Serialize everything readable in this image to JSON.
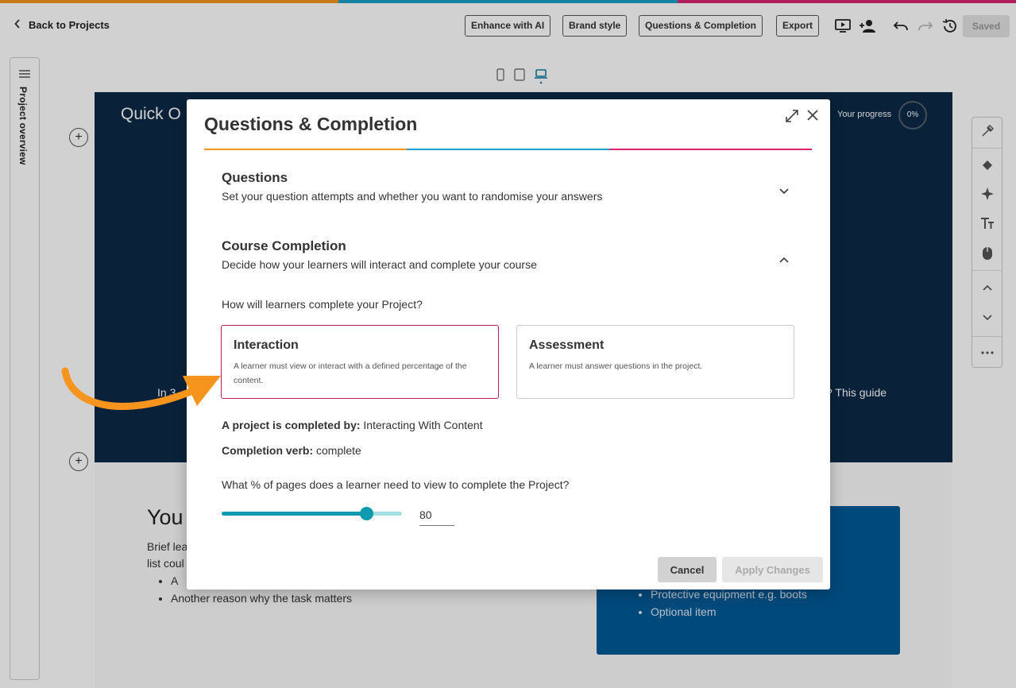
{
  "colors": {
    "orange": "#f7941d",
    "blue": "#1aa0c8",
    "pink": "#d6246e",
    "navy": "#0b2a47",
    "teal": "#0f9ab0"
  },
  "header": {
    "back_label": "Back to Projects",
    "buttons": {
      "enhance": "Enhance with AI",
      "brand": "Brand style",
      "questions": "Questions & Completion",
      "export": "Export"
    },
    "saved_label": "Saved"
  },
  "sidebar": {
    "label": "Project overview"
  },
  "canvas": {
    "title_fragment": "Quick O",
    "progress_label": "Your progress",
    "progress_value": "0%",
    "in_fragment": "In 3",
    "guide_fragment": "? This guide",
    "you_heading": "You",
    "brief_line1": "Brief lea",
    "brief_line2": "list coul",
    "bullets": [
      "A",
      "Another reason why the task matters"
    ],
    "blue_items": [
      "Protective equipment e.g. boots",
      "Optional item"
    ]
  },
  "modal": {
    "title": "Questions & Completion",
    "questions": {
      "title": "Questions",
      "desc": "Set your question attempts and whether you want to randomise your answers"
    },
    "completion": {
      "title": "Course Completion",
      "desc": "Decide how your learners will interact and complete your course"
    },
    "how_label": "How will learners complete your Project?",
    "cards": [
      {
        "title": "Interaction",
        "desc": "A learner must view or interact with a defined percentage of the content."
      },
      {
        "title": "Assessment",
        "desc": "A learner must answer questions in the project."
      }
    ],
    "completed_by_label": "A project is completed by:",
    "completed_by_value": "Interacting With Content",
    "verb_label": "Completion verb:",
    "verb_value": "complete",
    "pct_question": "What % of pages does a learner need to view to complete the Project?",
    "pct_value": "80",
    "slider_fraction": 0.8,
    "cancel_label": "Cancel",
    "apply_label": "Apply Changes"
  }
}
